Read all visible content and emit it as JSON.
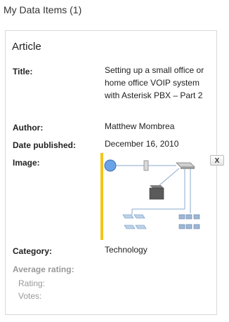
{
  "panel": {
    "title": "My Data Items (1)"
  },
  "item": {
    "type": "Article",
    "fields": {
      "title_label": "Title:",
      "title_value": "Setting up a small office or home office VOIP system with Asterisk PBX – Part 2",
      "author_label": "Author:",
      "author_value": "Matthew Mombrea",
      "date_label": "Date published:",
      "date_value": "December 16, 2010",
      "image_label": "Image:",
      "image_close_label": "X",
      "category_label": "Category:",
      "category_value": "Technology",
      "avg_rating_label": "Average rating:",
      "rating_label": "Rating:",
      "votes_label": "Votes:"
    },
    "image": {
      "accent_color": "#f5c518",
      "icons": [
        "internet-cloud-icon",
        "firewall-icon",
        "router-icon",
        "server-icon",
        "ip-phone-icon",
        "office-phone-icon"
      ]
    }
  }
}
